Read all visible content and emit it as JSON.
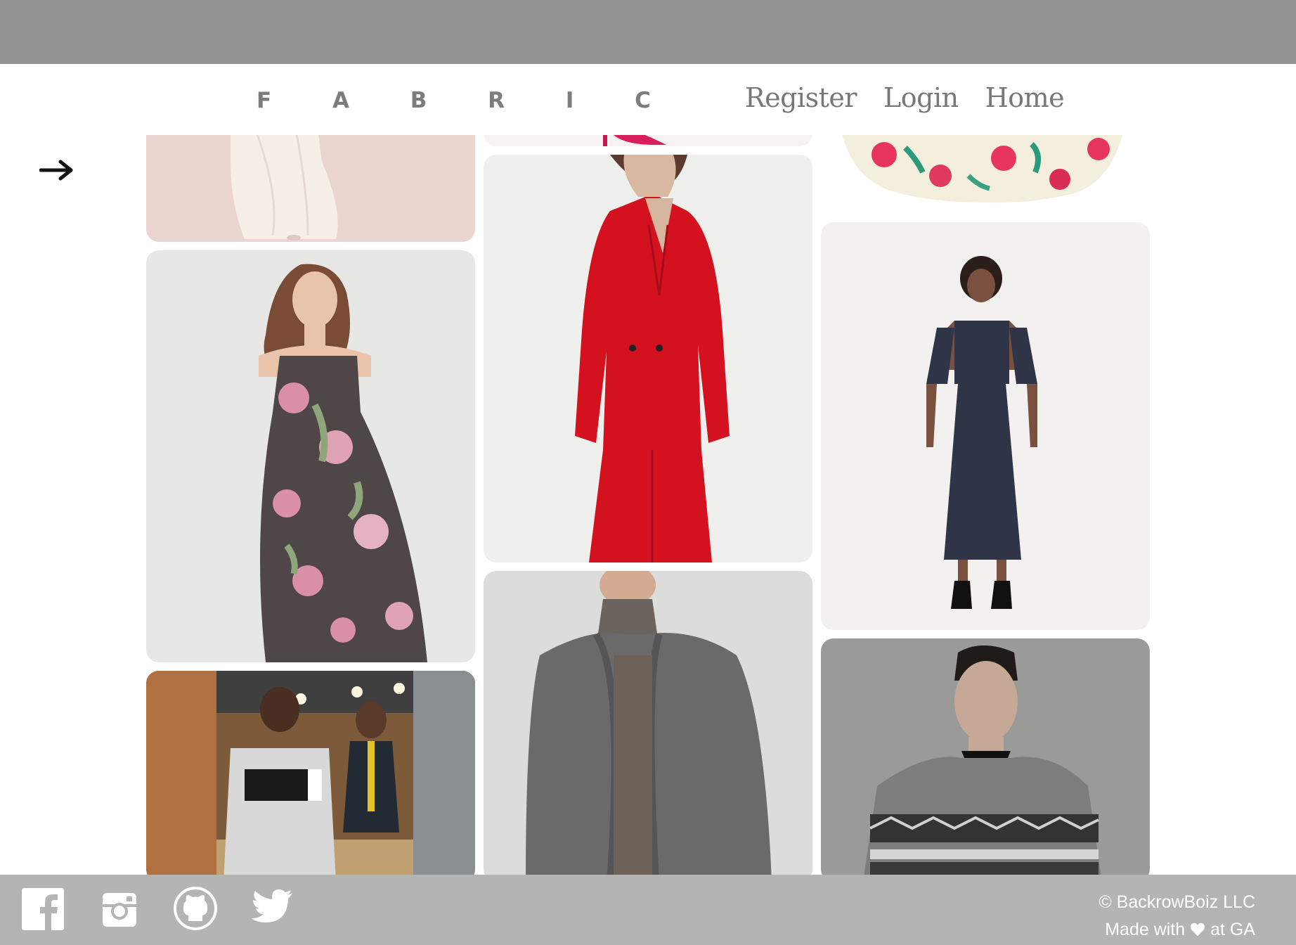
{
  "header": {
    "logo": "F A B R I C",
    "nav": [
      "Register",
      "Login",
      "Home"
    ]
  },
  "sidebar": {
    "toggle_icon": "arrow-right-icon"
  },
  "gallery": {
    "images": [
      "white-gown-photo",
      "red-heel-photo",
      "floral-skirt-photo",
      "red-suit-photo",
      "floral-strapless-dress-photo",
      "polka-dot-dress-photo",
      "tracksuit-athlete-photo",
      "grey-cardigan-photo",
      "patterned-sweater-photo"
    ]
  },
  "footer": {
    "social_icons": [
      "facebook-icon",
      "instagram-icon",
      "github-icon",
      "twitter-icon"
    ],
    "copyright": "© BackrowBoiz LLC",
    "made_prefix": "Made with",
    "made_suffix": "at GA",
    "heart_icon": "heart-icon"
  },
  "colors": {
    "topbar": "#939391",
    "footer": "#b4b4b3",
    "nav_text": "#777777",
    "logo_text": "#7c7c7c"
  }
}
